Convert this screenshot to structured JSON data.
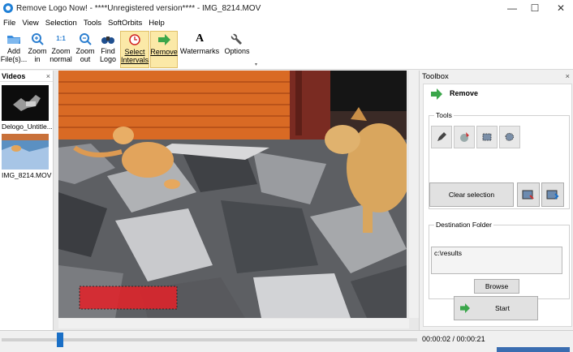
{
  "window": {
    "title": "Remove Logo Now! - ****Unregistered version**** - IMG_8214.MOV",
    "minimize_glyph": "—",
    "maximize_glyph": "☐",
    "close_glyph": "✕"
  },
  "menu": [
    "File",
    "View",
    "Selection",
    "Tools",
    "SoftOrbits",
    "Help"
  ],
  "toolbar": {
    "add": "Add File(s)...",
    "zoom_in": "Zoom in",
    "zoom_normal": "Zoom normal",
    "zoom_normal_icon": "1:1",
    "zoom_out": "Zoom out",
    "find_logo": "Find Logo",
    "select_intervals": "Select Intervals",
    "remove": "Remove",
    "watermarks": "Watermarks",
    "watermarks_icon": "A",
    "options": "Options"
  },
  "videos_panel": {
    "title": "Videos",
    "close": "×",
    "items": [
      {
        "label": "Delogo_Untitle..."
      },
      {
        "label": "IMG_8214.MOV"
      }
    ]
  },
  "toolbox": {
    "title": "Toolbox",
    "close": "×",
    "section_title": "Remove",
    "tools_label": "Tools",
    "clear_selection": "Clear selection",
    "destination_label": "Destination Folder",
    "destination_path": "c:\\results",
    "browse": "Browse",
    "start": "Start"
  },
  "status": {
    "time": "00:00:02 / 00:00:21",
    "playback_fraction": 0.14
  },
  "colors": {
    "accent": "#1a6fc6",
    "selection": "#e0232a",
    "active_tool": "#fbe9a7"
  }
}
